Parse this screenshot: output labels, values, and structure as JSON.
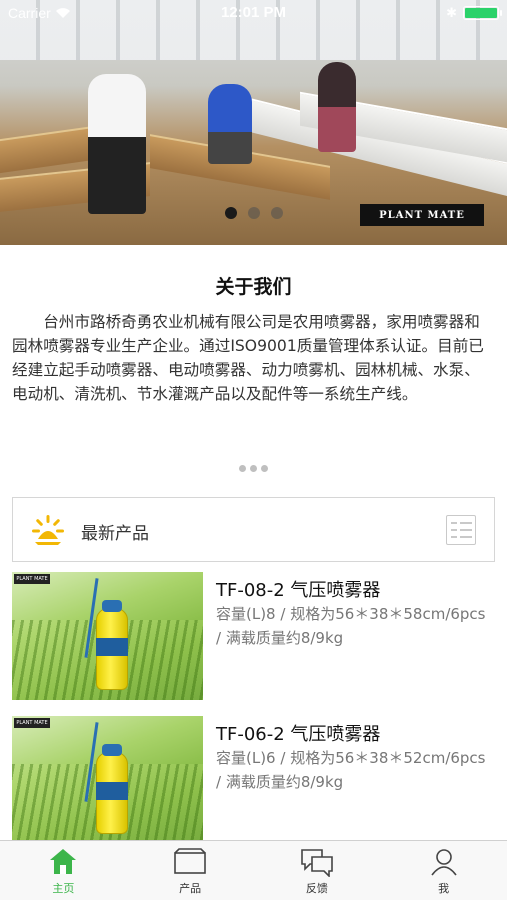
{
  "status_bar": {
    "carrier": "Carrier",
    "time": "12:01 PM",
    "battery_level": 1.0,
    "battery_color": "#2bd26a"
  },
  "banner": {
    "brand_text": "PLANT MATE",
    "slide_count": 3,
    "active_slide": 1
  },
  "about": {
    "title": "关于我们",
    "text": "台州市路桥奇勇农业机械有限公司是农用喷雾器，家用喷雾器和园林喷雾器专业生产企业。通过ISO9001质量管理体系认证。目前已经建立起手动喷雾器、电动喷雾器、动力喷雾机、园林机械、水泵、电动机、清洗机、节水灌溉产品以及配件等一系统生产线。"
  },
  "latest": {
    "label": "最新产品",
    "icon": "sun-icon",
    "list_icon": "list-icon",
    "accent": "#f2b705"
  },
  "products": [
    {
      "name": "TF-08-2 气压喷雾器",
      "desc": "容量(L)8 / 规格为56＊38＊58cm/6pcs / 满载质量约8/9kg",
      "thumb_logo": "PLANT MATE"
    },
    {
      "name": "TF-06-2 气压喷雾器",
      "desc": "容量(L)6 / 规格为56＊38＊52cm/6pcs / 满载质量约8/9kg",
      "thumb_logo": "PLANT MATE"
    }
  ],
  "tabs": [
    {
      "label": "主页",
      "icon": "home-icon",
      "active": true
    },
    {
      "label": "产品",
      "icon": "product-icon",
      "active": false
    },
    {
      "label": "反馈",
      "icon": "feedback-icon",
      "active": false
    },
    {
      "label": "我",
      "icon": "user-icon",
      "active": false
    }
  ],
  "colors": {
    "active_tab": "#3cb54a",
    "inactive_tab": "#333333"
  }
}
